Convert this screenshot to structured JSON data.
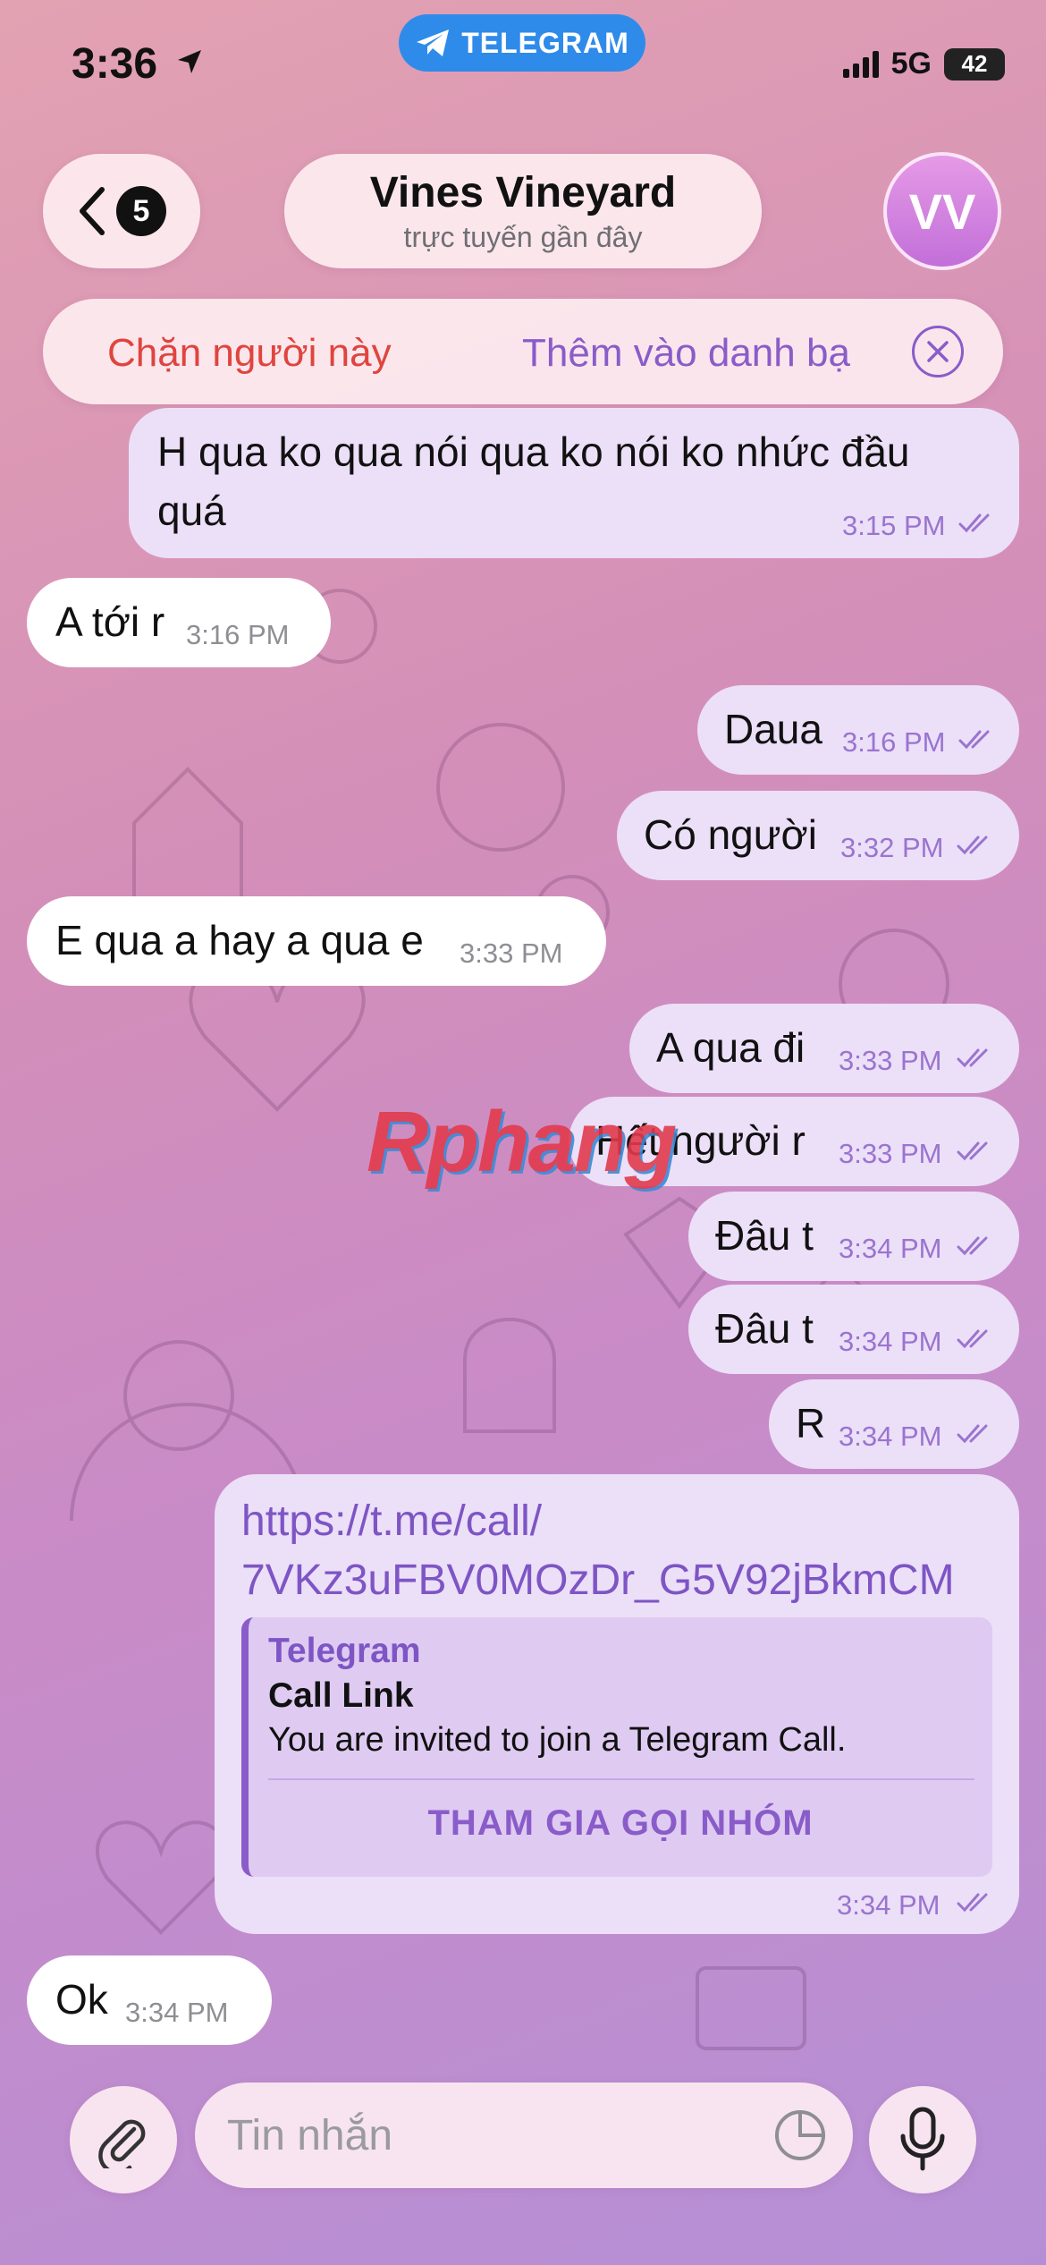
{
  "status_bar": {
    "time": "3:36",
    "telegram_label": "TELEGRAM",
    "network": "5G",
    "battery": "42"
  },
  "header": {
    "back_count": "5",
    "contact_name": "Vines Vineyard",
    "contact_status": "trực tuyến gần đây",
    "avatar_initials": "VV"
  },
  "action_bar": {
    "block_label": "Chặn người này",
    "add_contact_label": "Thêm vào danh bạ"
  },
  "messages": [
    {
      "direction": "out",
      "text": "H qua ko qua nói qua ko nói ko nhức đầu",
      "text2": "quá",
      "time": "3:15 PM"
    },
    {
      "direction": "in",
      "text": "A tới r",
      "time": "3:16 PM"
    },
    {
      "direction": "out",
      "text": "Daua",
      "time": "3:16 PM"
    },
    {
      "direction": "out",
      "text": "Có người",
      "time": "3:32 PM"
    },
    {
      "direction": "in",
      "text": "E qua a hay a qua e",
      "time": "3:33 PM"
    },
    {
      "direction": "out",
      "text": "A qua đi",
      "time": "3:33 PM"
    },
    {
      "direction": "out",
      "text": "Hết người r",
      "time": "3:33 PM"
    },
    {
      "direction": "out",
      "text": "Đâu t",
      "time": "3:34 PM"
    },
    {
      "direction": "out",
      "text": "Đâu t",
      "time": "3:34 PM"
    },
    {
      "direction": "out",
      "text": "R",
      "time": "3:34 PM"
    },
    {
      "direction": "out",
      "type": "link",
      "url_line1": "https://t.me/call/",
      "url_line2": "7VKz3uFBV0MOzDr_G5V92jBkmCM",
      "time": "3:34 PM",
      "preview": {
        "site": "Telegram",
        "title": "Call Link",
        "description": "You are invited to join a Telegram Call.",
        "button": "THAM GIA GỌI NHÓM"
      }
    },
    {
      "direction": "in",
      "text": "Ok",
      "time": "3:34 PM"
    }
  ],
  "composer": {
    "placeholder": "Tin nhắn"
  },
  "watermark": "Rphang",
  "colors": {
    "accent": "#8a5cc9",
    "block_red": "#e0443e",
    "telegram_blue": "#2f8bea",
    "outgoing_bubble": "#ecdff8",
    "incoming_bubble": "#ffffff"
  }
}
